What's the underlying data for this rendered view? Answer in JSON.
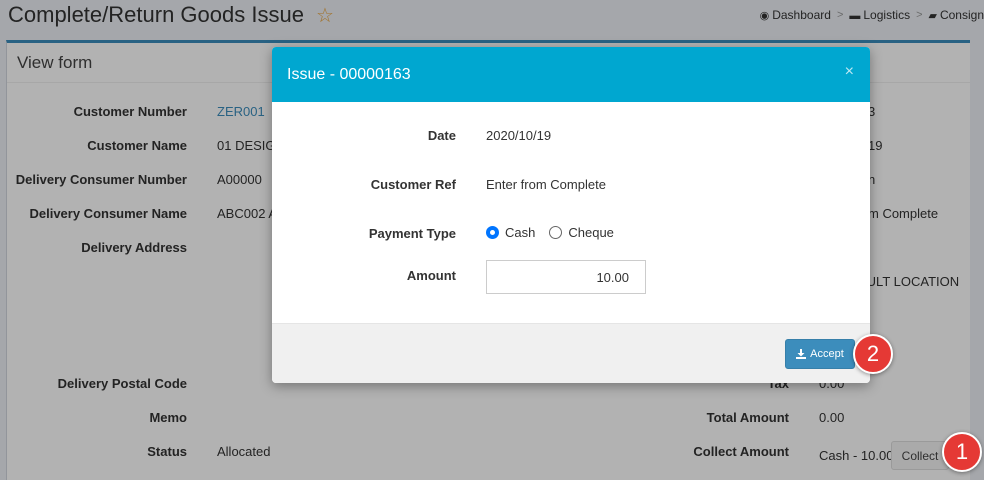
{
  "page": {
    "title": "Complete/Return Goods Issue",
    "breadcrumb": [
      {
        "label": "Dashboard"
      },
      {
        "label": "Logistics"
      },
      {
        "label": "Consign"
      }
    ]
  },
  "box": {
    "title": "View form"
  },
  "form_left": [
    {
      "label": "Customer Number",
      "value": "ZER001"
    },
    {
      "label": "Customer Name",
      "value": "01 DESIGN"
    },
    {
      "label": "Delivery Consumer Number",
      "value": "A00000"
    },
    {
      "label": "Delivery Consumer Name",
      "value": "ABC002 A"
    },
    {
      "label": "Delivery Address",
      "value": ""
    },
    {
      "label": "Delivery Postal Code",
      "value": ""
    },
    {
      "label": "Memo",
      "value": ""
    },
    {
      "label": "Status",
      "value": "Allocated"
    }
  ],
  "form_right": [
    {
      "label": "",
      "value": "3"
    },
    {
      "label": "",
      "value": "19"
    },
    {
      "label": "",
      "value": "n"
    },
    {
      "label": "",
      "value": "m Complete"
    },
    {
      "label": "",
      "value": "AULT LOCATION"
    },
    {
      "label": "Tax",
      "value": "0.00"
    },
    {
      "label": "Total Amount",
      "value": "0.00"
    },
    {
      "label": "Collect Amount",
      "value": "Cash - 10.00"
    }
  ],
  "collect_button": "Collect",
  "modal": {
    "title": "Issue - 00000163",
    "close": "×",
    "date_label": "Date",
    "date_value": "2020/10/19",
    "customer_ref_label": "Customer Ref",
    "customer_ref_value": "Enter from Complete",
    "payment_type_label": "Payment Type",
    "payment_options": [
      {
        "label": "Cash",
        "checked": true
      },
      {
        "label": "Cheque",
        "checked": false
      }
    ],
    "amount_label": "Amount",
    "amount_value": "10.00",
    "accept_label": "Accept"
  },
  "badges": [
    "1",
    "2"
  ],
  "colors": {
    "header_blue": "#00a7d0",
    "button_blue": "#3c8dbc",
    "badge_red": "#e53935",
    "star": "#e8a33d"
  }
}
